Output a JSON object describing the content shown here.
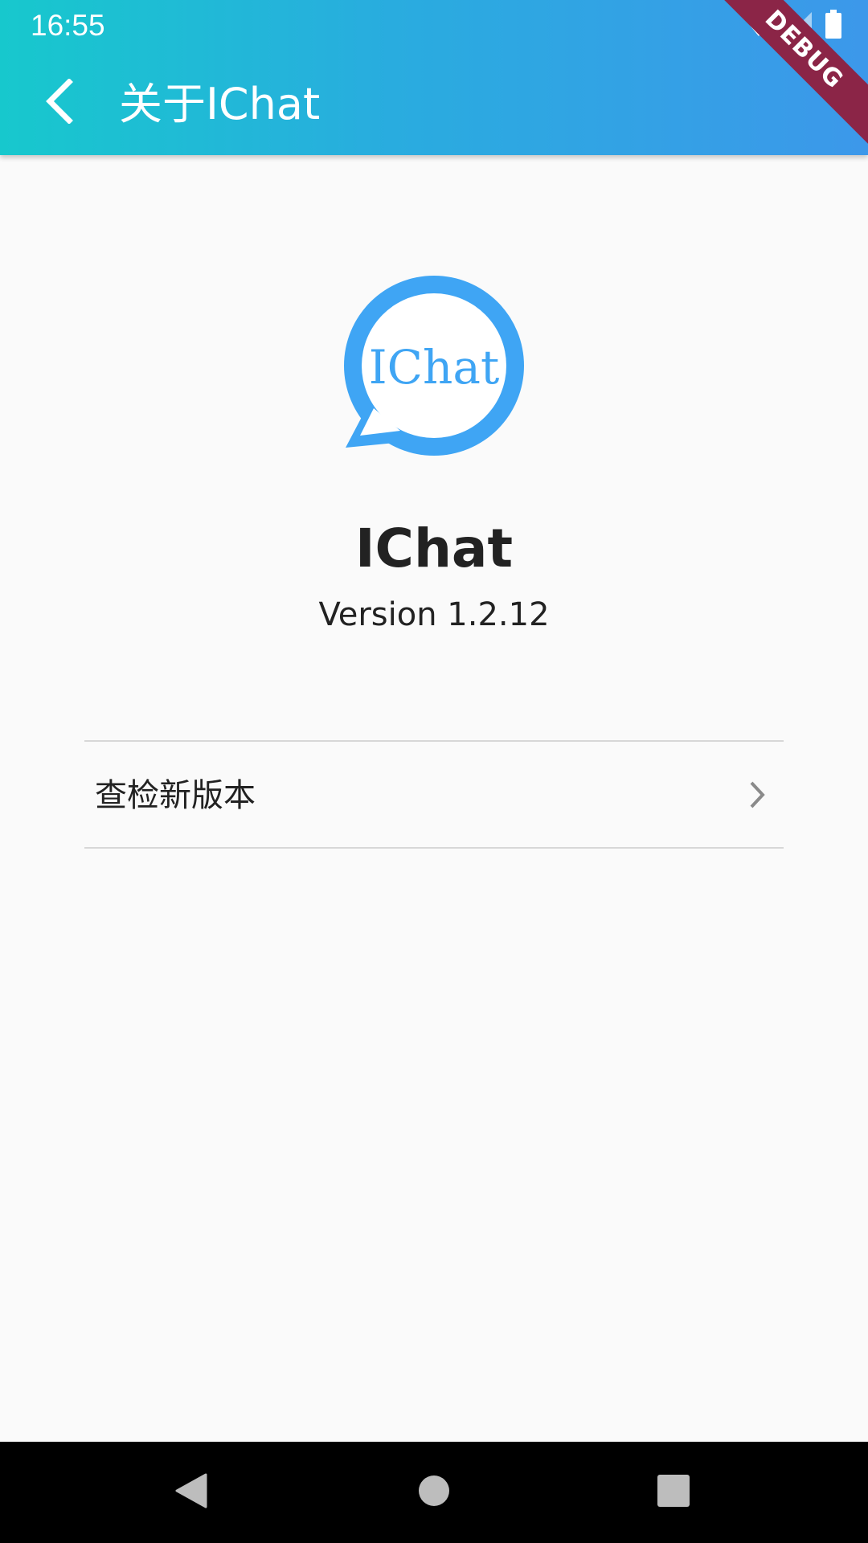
{
  "status_bar": {
    "time": "16:55",
    "icons": [
      "wifi-off-icon",
      "signal-icon",
      "battery-icon"
    ]
  },
  "debug_banner": {
    "label": "DEBUG",
    "color": "#8b2547"
  },
  "app_bar": {
    "back_icon": "chevron-left-icon",
    "title": "关于IChat",
    "gradient": [
      "#17c8cd",
      "#3c98ea"
    ]
  },
  "logo": {
    "text": "IChat",
    "color": "#3fa5f4"
  },
  "app_info": {
    "name": "IChat",
    "version": "Version 1.2.12"
  },
  "menu": {
    "items": [
      {
        "label": "查检新版本",
        "icon": "chevron-right-icon"
      }
    ]
  },
  "nav_bar": {
    "buttons": [
      "back-triangle-icon",
      "home-circle-icon",
      "recents-square-icon"
    ]
  }
}
